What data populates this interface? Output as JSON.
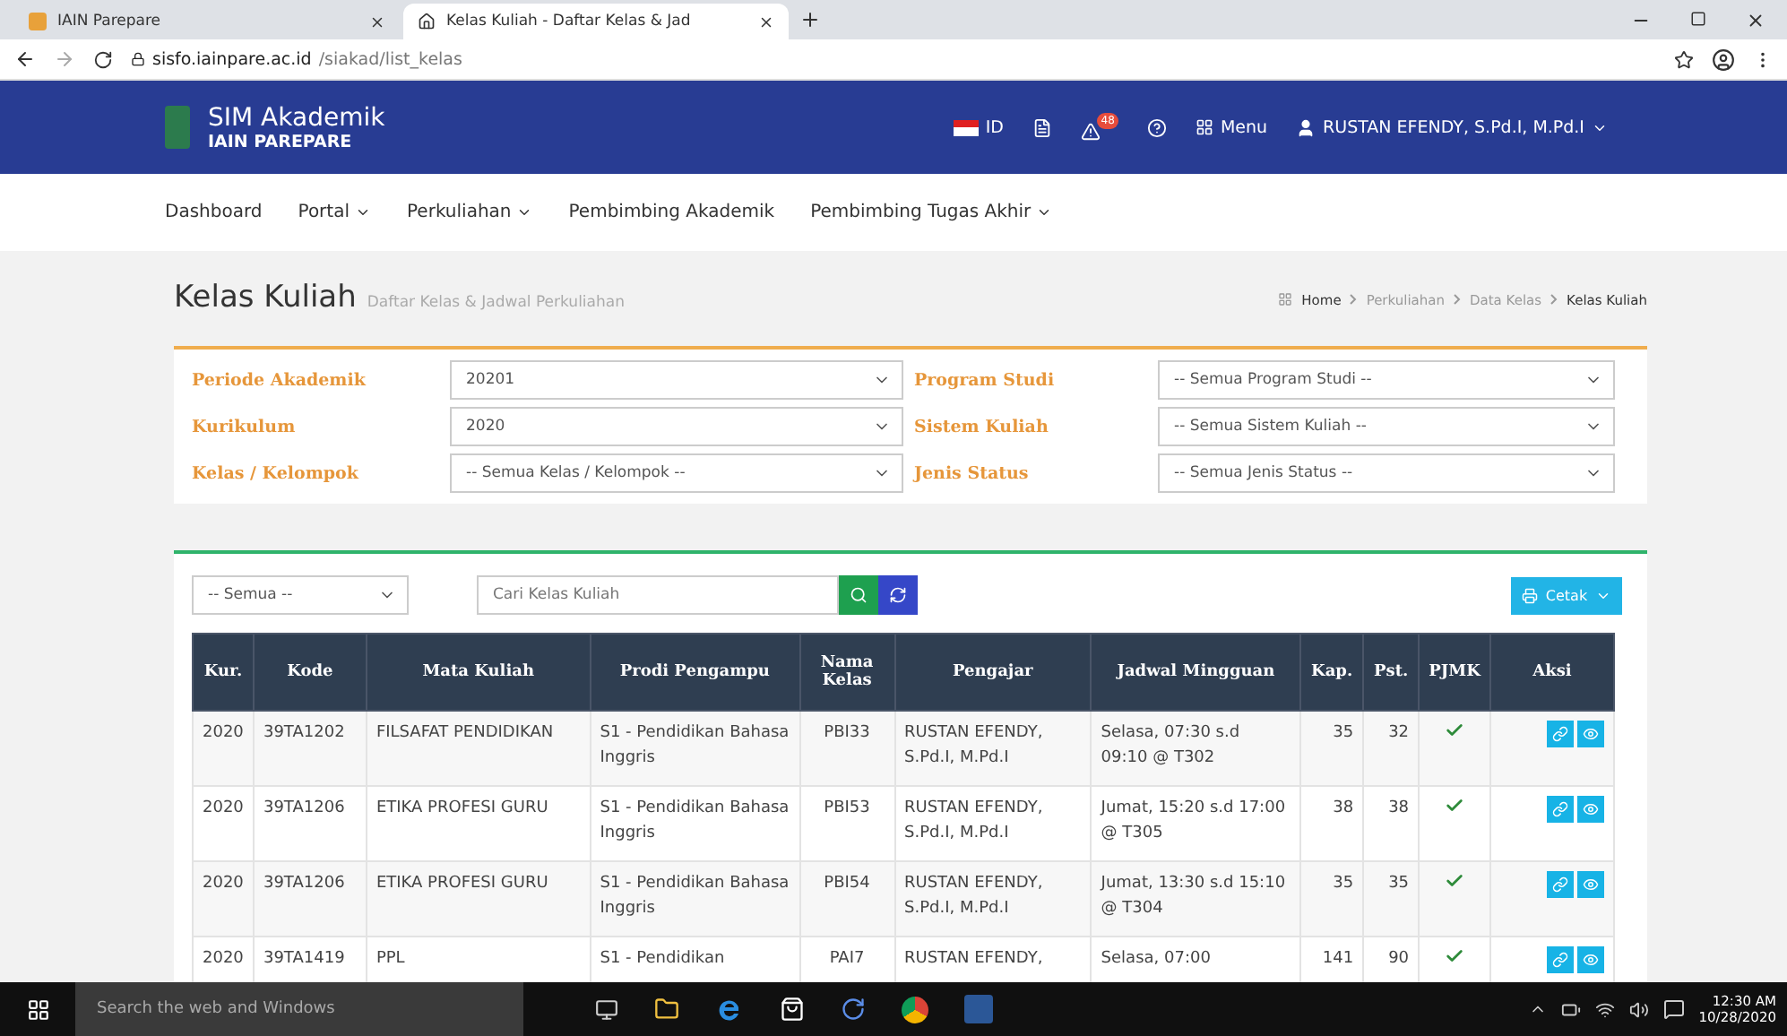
{
  "browser": {
    "tabs": [
      {
        "title": "IAIN Parepare",
        "selected": false
      },
      {
        "title": "Kelas Kuliah - Daftar Kelas & Jad",
        "selected": true
      }
    ],
    "url_host": "sisfo.iainpare.ac.id",
    "url_path": "/siakad/list_kelas"
  },
  "header": {
    "app_name": "SIM Akademik",
    "institution": "IAIN PAREPARE",
    "language": "ID",
    "notification_count": "48",
    "menu": "Menu",
    "user": "RUSTAN EFENDY, S.Pd.I, M.Pd.I"
  },
  "nav": [
    {
      "label": "Dashboard",
      "dropdown": false
    },
    {
      "label": "Portal",
      "dropdown": true
    },
    {
      "label": "Perkuliahan",
      "dropdown": true
    },
    {
      "label": "Pembimbing Akademik",
      "dropdown": false
    },
    {
      "label": "Pembimbing Tugas Akhir",
      "dropdown": true
    }
  ],
  "page": {
    "title": "Kelas Kuliah",
    "subtitle": "Daftar Kelas & Jadwal Perkuliahan",
    "breadcrumb": [
      "Home",
      "Perkuliahan",
      "Data Kelas",
      "Kelas Kuliah"
    ]
  },
  "filters": [
    {
      "label": "Periode Akademik",
      "value": "20201"
    },
    {
      "label": "Program Studi",
      "value": "-- Semua Program Studi --"
    },
    {
      "label": "Kurikulum",
      "value": "2020"
    },
    {
      "label": "Sistem Kuliah",
      "value": "-- Semua Sistem Kuliah --"
    },
    {
      "label": "Kelas / Kelompok",
      "value": "-- Semua Kelas / Kelompok --"
    },
    {
      "label": "Jenis Status",
      "value": "-- Semua Jenis Status --"
    }
  ],
  "toolbar": {
    "scope": "-- Semua --",
    "search_placeholder": "Cari Kelas Kuliah",
    "print": "Cetak"
  },
  "table": {
    "columns": [
      "Kur.",
      "Kode",
      "Mata Kuliah",
      "Prodi Pengampu",
      "Nama Kelas",
      "Pengajar",
      "Jadwal Mingguan",
      "Kap.",
      "Pst.",
      "PJMK",
      "Aksi"
    ],
    "rows": [
      {
        "kur": "2020",
        "kode": "39TA1202",
        "mata_kuliah": "FILSAFAT PENDIDIKAN",
        "prodi": "S1 - Pendidikan Bahasa Inggris",
        "kelas": "PBI33",
        "pengajar": "RUSTAN EFENDY, S.Pd.I, M.Pd.I",
        "jadwal": "Selasa, 07:30 s.d 09:10 @ T302",
        "kap": "35",
        "pst": "32",
        "pjmk": true
      },
      {
        "kur": "2020",
        "kode": "39TA1206",
        "mata_kuliah": "ETIKA PROFESI GURU",
        "prodi": "S1 - Pendidikan Bahasa Inggris",
        "kelas": "PBI53",
        "pengajar": "RUSTAN EFENDY, S.Pd.I, M.Pd.I",
        "jadwal": "Jumat, 15:20 s.d 17:00 @ T305",
        "kap": "38",
        "pst": "38",
        "pjmk": true
      },
      {
        "kur": "2020",
        "kode": "39TA1206",
        "mata_kuliah": "ETIKA PROFESI GURU",
        "prodi": "S1 - Pendidikan Bahasa Inggris",
        "kelas": "PBI54",
        "pengajar": "RUSTAN EFENDY, S.Pd.I, M.Pd.I",
        "jadwal": "Jumat, 13:30 s.d 15:10 @ T304",
        "kap": "35",
        "pst": "35",
        "pjmk": true
      },
      {
        "kur": "2020",
        "kode": "39TA1419",
        "mata_kuliah": "PPL",
        "prodi": "S1 - Pendidikan",
        "kelas": "PAI7",
        "pengajar": "RUSTAN EFENDY,",
        "jadwal": "Selasa, 07:00",
        "kap": "141",
        "pst": "90",
        "pjmk": true
      }
    ]
  },
  "taskbar": {
    "search": "Search the web and Windows",
    "time": "12:30 AM",
    "date": "10/28/2020"
  }
}
